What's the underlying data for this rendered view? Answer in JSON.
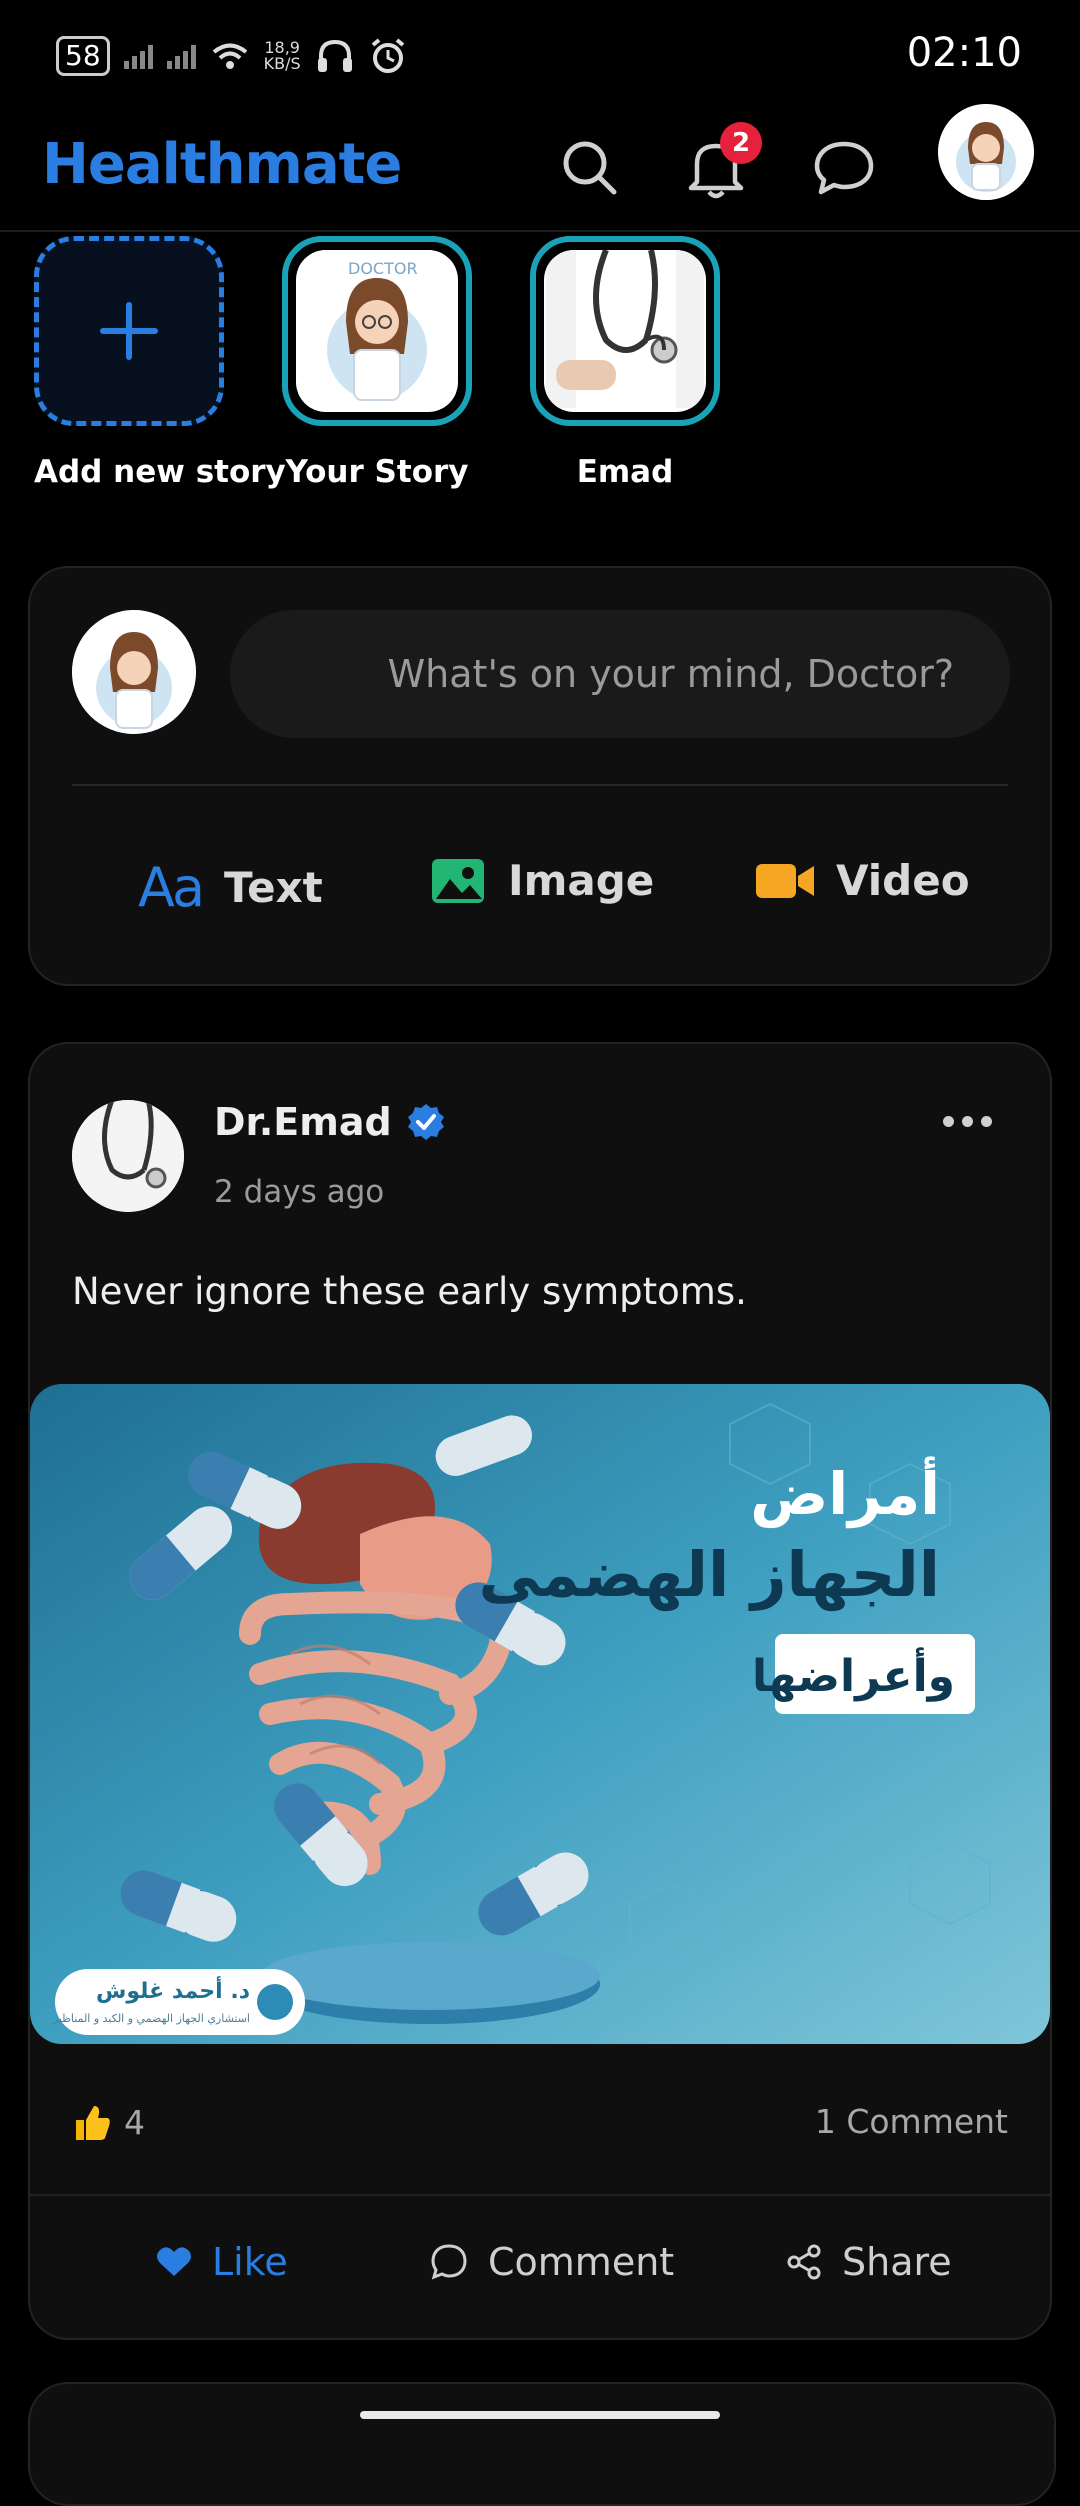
{
  "status_bar": {
    "battery": "58",
    "net_speed_top": "18,9",
    "net_speed_bottom": "KB/S",
    "time": "02:10"
  },
  "header": {
    "brand": "Healthmate",
    "notification_count": "2",
    "icons": [
      "search-icon",
      "bell-icon",
      "chat-icon",
      "profile-avatar"
    ]
  },
  "stories": [
    {
      "label": "Add new story",
      "type": "add"
    },
    {
      "label": "Your Story",
      "type": "user"
    },
    {
      "label": "Emad",
      "type": "user"
    }
  ],
  "composer": {
    "placeholder": "What's on your mind, Doctor?",
    "actions": [
      {
        "label": "Text",
        "icon": "text-format-icon",
        "color": "#2a7de1"
      },
      {
        "label": "Image",
        "icon": "image-icon",
        "color": "#22b573"
      },
      {
        "label": "Video",
        "icon": "video-camera-icon",
        "color": "#f5a623"
      }
    ]
  },
  "post": {
    "author": "Dr.Emad",
    "time": "2 days ago",
    "text": "Never ignore these early symptoms.",
    "image": {
      "title_line1": "أمراض",
      "title_line2": "الجهاز الهضمى",
      "title_line3": "وأعراضها",
      "logo_name": "د. أحمد غلوش",
      "logo_subtitle": "استشاري الجهاز الهضمي و الكبد و المناظير"
    },
    "likes": "4",
    "comments": "1 Comment",
    "actions": {
      "like": "Like",
      "comment": "Comment",
      "share": "Share"
    }
  },
  "colors": {
    "brand": "#2a7de1",
    "badge": "#e5213b",
    "story_ring": "#1aa3b8"
  }
}
